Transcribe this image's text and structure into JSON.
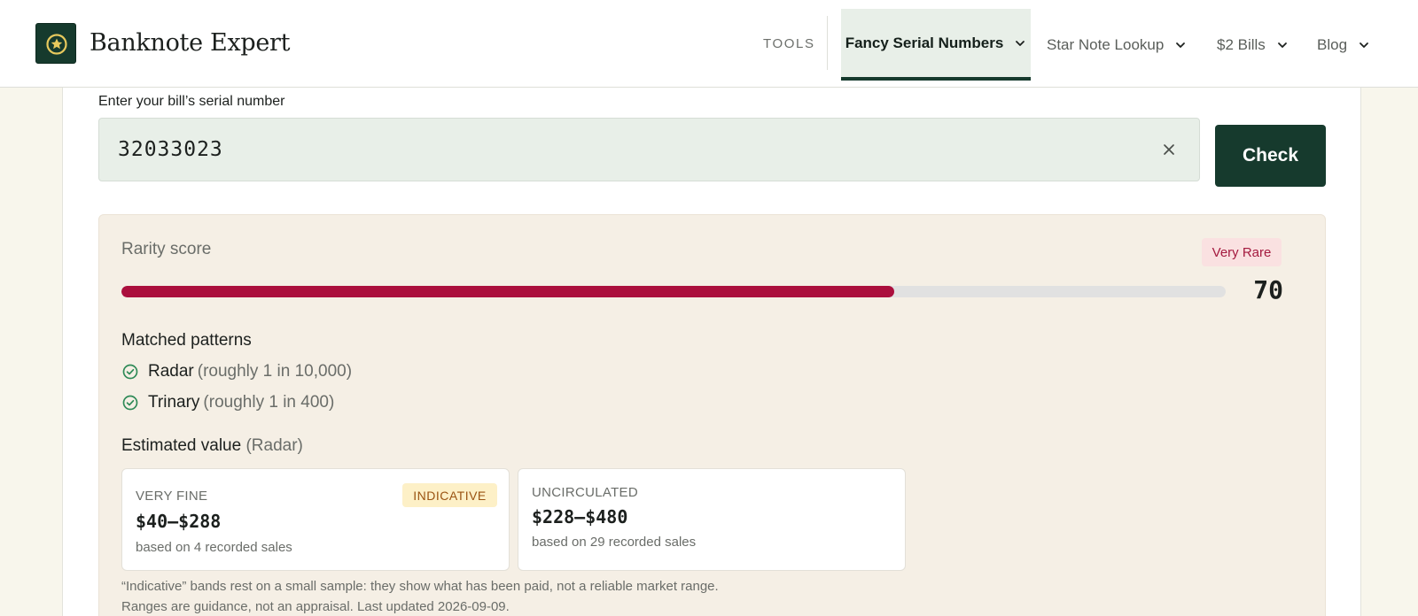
{
  "header": {
    "brand": "Banknote Expert",
    "tools_label": "TOOLS",
    "nav": [
      {
        "label": "Fancy Serial Numbers",
        "active": true
      },
      {
        "label": "Star Note Lookup",
        "active": false
      },
      {
        "label": "$2 Bills",
        "active": false
      },
      {
        "label": "Blog",
        "active": false
      }
    ]
  },
  "form": {
    "label": "Enter your bill’s serial number",
    "serial_value": "32033023",
    "check_label": "Check"
  },
  "rarity": {
    "label": "Rarity score",
    "badge": "Very Rare",
    "score": "70",
    "score_fraction": 0.7
  },
  "patterns": {
    "title": "Matched patterns",
    "items": [
      {
        "name": "Radar",
        "odds": "(roughly 1 in 10,000)"
      },
      {
        "name": "Trinary",
        "odds": "(roughly 1 in 400)"
      }
    ]
  },
  "value": {
    "title": "Estimated value",
    "title_suffix": "(Radar)",
    "cards": [
      {
        "grade": "VERY FINE",
        "tag": "INDICATIVE",
        "price": "$40–$288",
        "sales": "based on 4 recorded sales"
      },
      {
        "grade": "UNCIRCULATED",
        "tag": "",
        "price": "$228–$480",
        "sales": "based on 29 recorded sales"
      }
    ]
  },
  "footnotes": [
    "“Indicative” bands rest on a small sample: they show what has been paid, not a reliable market range.",
    "Ranges are guidance, not an appraisal. Last updated 2026-09-09."
  ],
  "colors": {
    "brand_green": "#163a2d",
    "rarity_red": "#ab0f3d",
    "panel_bg": "#f5efe5",
    "page_bg": "#f8f6ec"
  },
  "icons": {
    "logo": "star-badge-icon",
    "nav_dropdown": "chevron-down-icon",
    "clear": "close-icon",
    "matched": "check-circle-icon"
  }
}
